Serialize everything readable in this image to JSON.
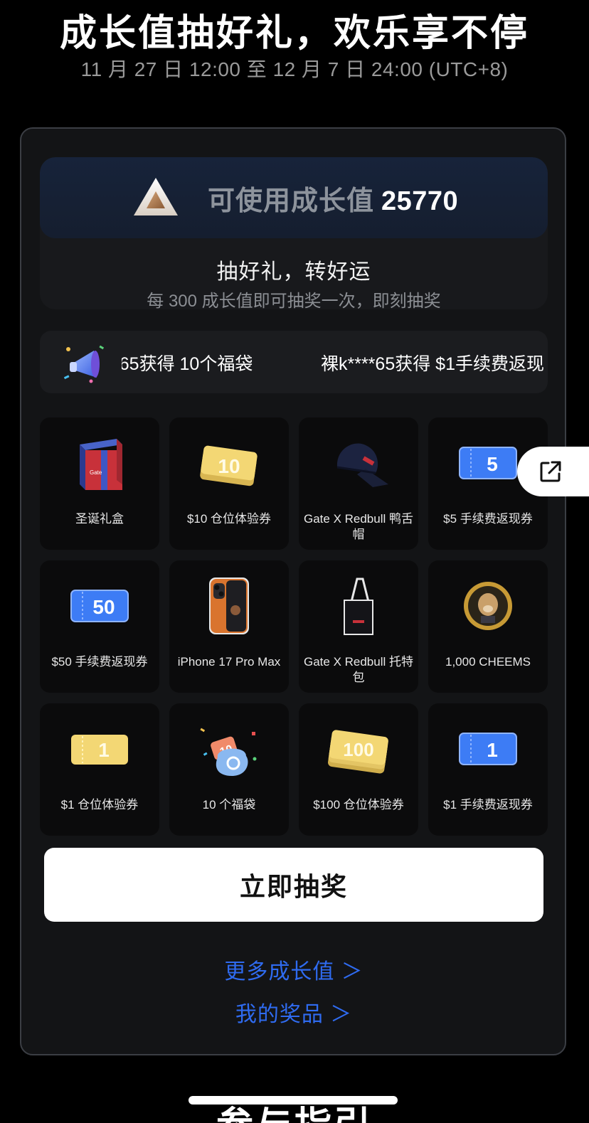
{
  "header": {
    "title": "成长值抽好礼，欢乐享不停",
    "subtitle": "11 月 27 日 12:00 至 12 月 7 日 24:00 (UTC+8)"
  },
  "balance": {
    "label": "可使用成长值",
    "value": "25770",
    "slogan": "抽好礼，转好运",
    "rule": "每 300 成长值即可抽奖一次，即刻抽奖"
  },
  "ticker": {
    "items": [
      "'65获得 10个福袋",
      "裸k****65获得 $1手续费返现"
    ]
  },
  "prizes": [
    {
      "name": "圣诞礼盒",
      "icon": "gift-box-icon"
    },
    {
      "name": "$10 仓位体验券",
      "icon": "gold-ticket-10-icon",
      "badge": "10"
    },
    {
      "name": "Gate X Redbull 鸭舌帽",
      "icon": "cap-icon"
    },
    {
      "name": "$5 手续费返现券",
      "icon": "blue-ticket-5-icon",
      "badge": "5"
    },
    {
      "name": "$50 手续费返现券",
      "icon": "blue-ticket-50-icon",
      "badge": "50"
    },
    {
      "name": "iPhone 17 Pro Max",
      "icon": "phone-icon"
    },
    {
      "name": "Gate X Redbull 托特包",
      "icon": "tote-bag-icon"
    },
    {
      "name": "1,000 CHEEMS",
      "icon": "cheems-coin-icon"
    },
    {
      "name": "$1 仓位体验券",
      "icon": "gold-ticket-1-icon",
      "badge": "1"
    },
    {
      "name": "10 个福袋",
      "icon": "lucky-bag-icon",
      "badge": "10"
    },
    {
      "name": "$100 仓位体验券",
      "icon": "gold-ticket-100-icon",
      "badge": "100"
    },
    {
      "name": "$1 手续费返现券",
      "icon": "blue-ticket-1-icon",
      "badge": "1"
    }
  ],
  "actions": {
    "draw_label": "立即抽奖",
    "more_growth_label": "更多成长值 ＞",
    "my_prizes_label": "我的奖品 ＞"
  },
  "footer": {
    "next_section_title": "参与指引"
  },
  "colors": {
    "background": "#000000",
    "panel": "#131416",
    "link": "#2f6bf0",
    "blue_ticket": "#3d7cf5",
    "gold_ticket": "#f3d774"
  }
}
